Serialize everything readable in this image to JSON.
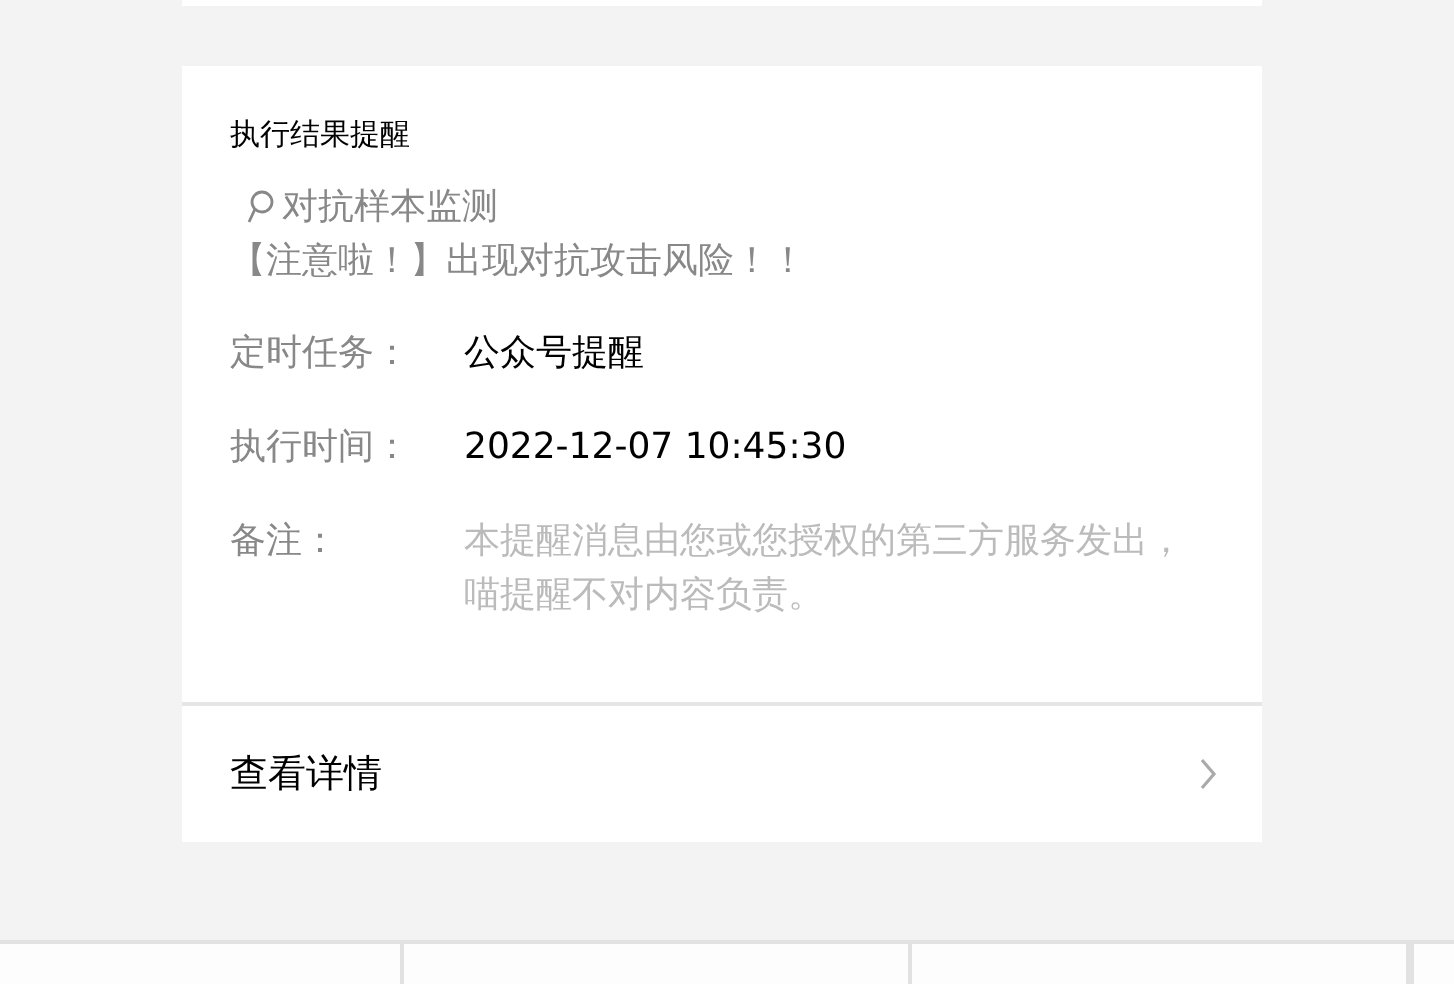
{
  "card": {
    "title": "执行结果提醒",
    "subject": "对抗样本监测",
    "message": "【注意啦！】出现对抗攻击风险！！",
    "fields": [
      {
        "label": "定时任务：",
        "value": "公众号提醒",
        "kind": "value"
      },
      {
        "label": "执行时间：",
        "value": "2022-12-07 10:45:30",
        "kind": "value"
      },
      {
        "label": "备注：",
        "value": "本提醒消息由您或您授权的第三方服务发出，喵提醒不对内容负责。",
        "kind": "note"
      }
    ],
    "link": "查看详情"
  }
}
